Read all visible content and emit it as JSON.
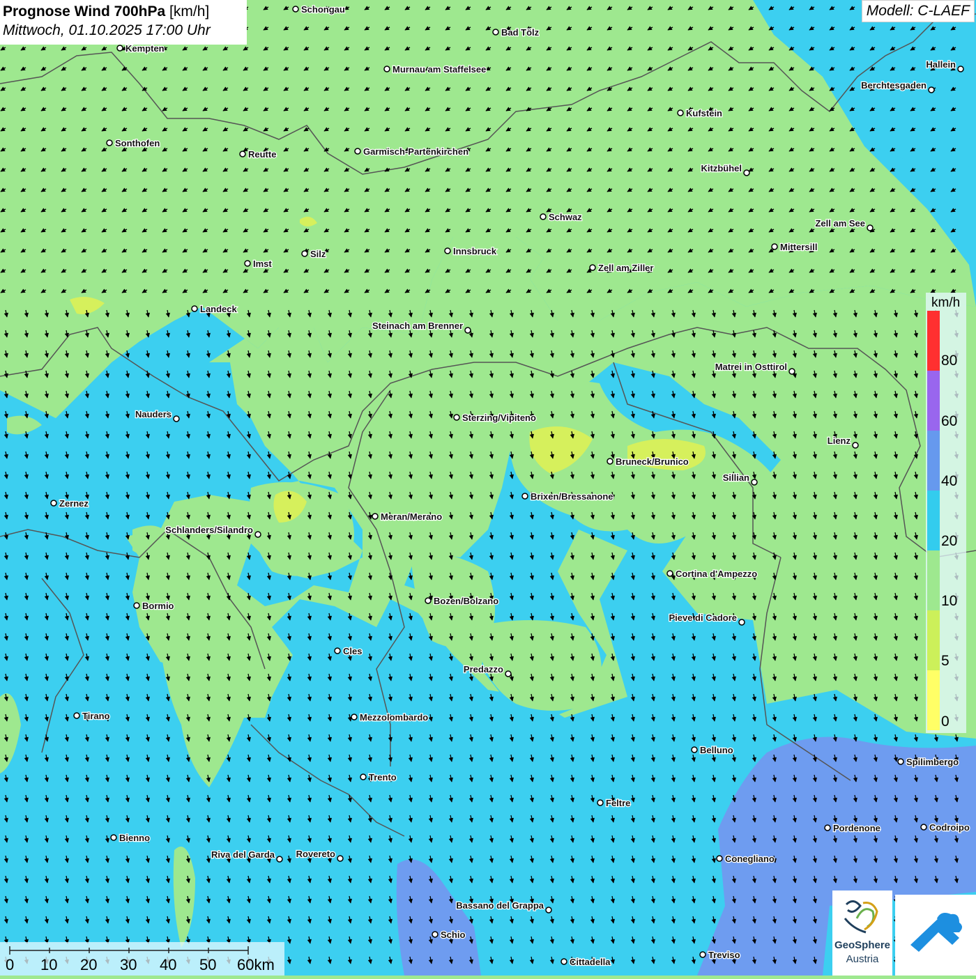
{
  "header": {
    "title": "Prognose Wind 700hPa",
    "unit": "[km/h]",
    "datetime": "Mittwoch, 01.10.2025 17:00 Uhr"
  },
  "model": "Modell: C-LAEF",
  "legend": {
    "title": "km/h",
    "ticks": [
      "80",
      "60",
      "40",
      "20",
      "10",
      "5",
      "0"
    ],
    "colors": [
      "#ff3030",
      "#9966ee",
      "#6699ee",
      "#33ccee",
      "#9ee88f",
      "#ccf05a",
      "#ffff66"
    ]
  },
  "scale_bar": {
    "labels": [
      "0",
      "10",
      "20",
      "30",
      "40",
      "50",
      "60km"
    ]
  },
  "logos": {
    "geosphere_name": "GeoSphere",
    "geosphere_sub": "Austria"
  },
  "cities": [
    {
      "name": "Schongau",
      "side": "right"
    },
    {
      "name": "Bad Tölz",
      "side": "right"
    },
    {
      "name": "Kempten",
      "side": "right"
    },
    {
      "name": "Murnau am Staffelsee",
      "side": "right"
    },
    {
      "name": "Hallein",
      "side": "left"
    },
    {
      "name": "Berchtesgaden",
      "side": "left"
    },
    {
      "name": "Kufstein",
      "side": "right"
    },
    {
      "name": "Sonthofen",
      "side": "right"
    },
    {
      "name": "Reutte",
      "side": "right"
    },
    {
      "name": "Garmisch-Partenkirchen",
      "side": "right"
    },
    {
      "name": "Kitzbühel",
      "side": "left"
    },
    {
      "name": "Schwaz",
      "side": "right"
    },
    {
      "name": "Zell am See",
      "side": "left"
    },
    {
      "name": "Mittersill",
      "side": "right"
    },
    {
      "name": "Innsbruck",
      "side": "right"
    },
    {
      "name": "Silz",
      "side": "right"
    },
    {
      "name": "Imst",
      "side": "right"
    },
    {
      "name": "Zell am Ziller",
      "side": "right"
    },
    {
      "name": "Landeck",
      "side": "right"
    },
    {
      "name": "Steinach am Brenner",
      "side": "left"
    },
    {
      "name": "Matrei in Osttirol",
      "side": "left"
    },
    {
      "name": "Nauders",
      "side": "left"
    },
    {
      "name": "Sterzing/Vipiteno",
      "side": "right"
    },
    {
      "name": "Lienz",
      "side": "left"
    },
    {
      "name": "Bruneck/Brunico",
      "side": "right"
    },
    {
      "name": "Sillian",
      "side": "left"
    },
    {
      "name": "Brixen/Bressanone",
      "side": "right"
    },
    {
      "name": "Zernez",
      "side": "right"
    },
    {
      "name": "Meran/Merano",
      "side": "right"
    },
    {
      "name": "Schlanders/Silandro",
      "side": "left"
    },
    {
      "name": "Cortina d'Ampezzo",
      "side": "right"
    },
    {
      "name": "Bozen/Bolzano",
      "side": "right"
    },
    {
      "name": "Bormio",
      "side": "right"
    },
    {
      "name": "Pieve di Cadore",
      "side": "left"
    },
    {
      "name": "Cles",
      "side": "right"
    },
    {
      "name": "Predazzo",
      "side": "left"
    },
    {
      "name": "Tirano",
      "side": "right"
    },
    {
      "name": "Mezzolombardo",
      "side": "right"
    },
    {
      "name": "Belluno",
      "side": "right"
    },
    {
      "name": "Spilimbergo",
      "side": "right"
    },
    {
      "name": "Trento",
      "side": "right"
    },
    {
      "name": "Feltre",
      "side": "right"
    },
    {
      "name": "Bienno",
      "side": "right"
    },
    {
      "name": "Pordenone",
      "side": "right"
    },
    {
      "name": "Codroipo",
      "side": "right"
    },
    {
      "name": "Riva del Garda",
      "side": "left"
    },
    {
      "name": "Rovereto",
      "side": "left"
    },
    {
      "name": "Conegliano",
      "side": "right"
    },
    {
      "name": "Bassano del Grappa",
      "side": "left"
    },
    {
      "name": "Schio",
      "side": "right"
    },
    {
      "name": "Treviso",
      "side": "right"
    },
    {
      "name": "Cittadella",
      "side": "right"
    }
  ]
}
